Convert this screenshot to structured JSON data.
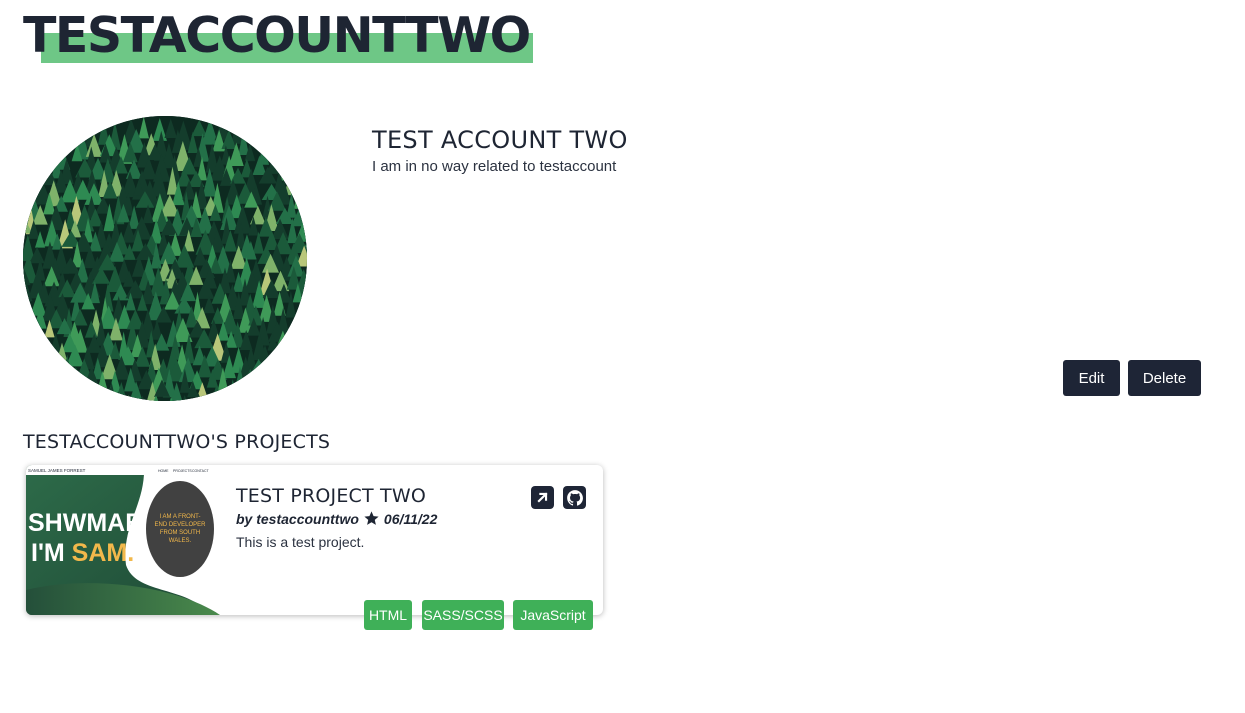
{
  "header": {
    "username": "TESTACCOUNTTWO",
    "highlight_color": "#6ec786"
  },
  "profile": {
    "name": "TEST ACCOUNT TWO",
    "bio": "I am in no way related to testaccount",
    "avatar_icon": "forest-avatar-image"
  },
  "actions": {
    "edit_label": "Edit",
    "delete_label": "Delete",
    "button_color": "#1e2536"
  },
  "projects": {
    "heading": "TESTACCOUNTTWO'S PROJECTS",
    "items": [
      {
        "title": "TEST PROJECT TWO",
        "by": "by testaccounttwo",
        "date": "06/11/22",
        "description": "This is a test project.",
        "thumbnail": {
          "site_name": "SAMUEL JAMES FORREST",
          "nav": [
            "HOME",
            "PROJECTS",
            "CONTACT"
          ],
          "hero_line1": "SHWMAE,",
          "hero_line2_a": "I'M ",
          "hero_line2_b": "SAM.",
          "circle_text": [
            "I AM A FRONT-",
            "END DEVELOPER",
            "FROM SOUTH",
            "WALES."
          ]
        },
        "link_icon": "external-link-icon",
        "repo_icon": "github-icon",
        "tags": [
          "HTML",
          "SASS/SCSS",
          "JavaScript"
        ],
        "tag_color": "#3fb058"
      }
    ]
  }
}
